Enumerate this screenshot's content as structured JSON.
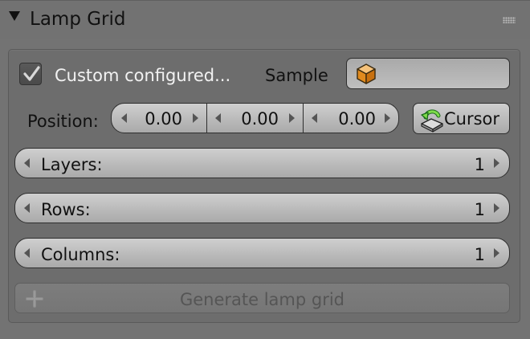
{
  "panel": {
    "title": "Lamp Grid",
    "collapse_icon": "triangle-down-icon",
    "grip_icon": "drag-grip-icon"
  },
  "custom": {
    "checked": true,
    "label": "Custom configured..."
  },
  "sample": {
    "label": "Sample",
    "icon": "object-cube-icon",
    "value": ""
  },
  "position": {
    "label": "Position:",
    "x": "0.00",
    "y": "0.00",
    "z": "0.00"
  },
  "cursor_button": {
    "label": "Cursor",
    "icon": "cursor-snap-icon"
  },
  "fields": [
    {
      "label": "Layers:",
      "value": "1"
    },
    {
      "label": "Rows:",
      "value": "1"
    },
    {
      "label": "Columns:",
      "value": "1"
    }
  ],
  "generate": {
    "label": "Generate lamp grid",
    "icon": "plus-icon",
    "enabled": false
  },
  "colors": {
    "panel_bg": "#727272",
    "widget_light": "#cfcfcf",
    "widget_dark": "#a9a9a9",
    "outline": "#2e2e2e",
    "cube_orange": "#f0a030"
  }
}
